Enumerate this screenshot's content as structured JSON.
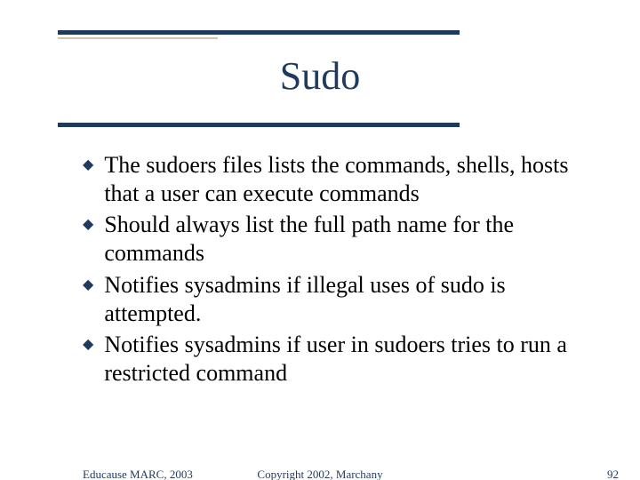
{
  "title": "Sudo",
  "bullets": [
    "The sudoers files lists the commands, shells, hosts that a user can execute commands",
    "Should always list the full path name for the commands",
    "Notifies sysadmins if illegal uses of sudo is attempted.",
    "Notifies sysadmins if user in sudoers tries to run a restricted command"
  ],
  "footer": {
    "left": "Educause MARC, 2003",
    "center": "Copyright 2002, Marchany",
    "right": "92"
  }
}
